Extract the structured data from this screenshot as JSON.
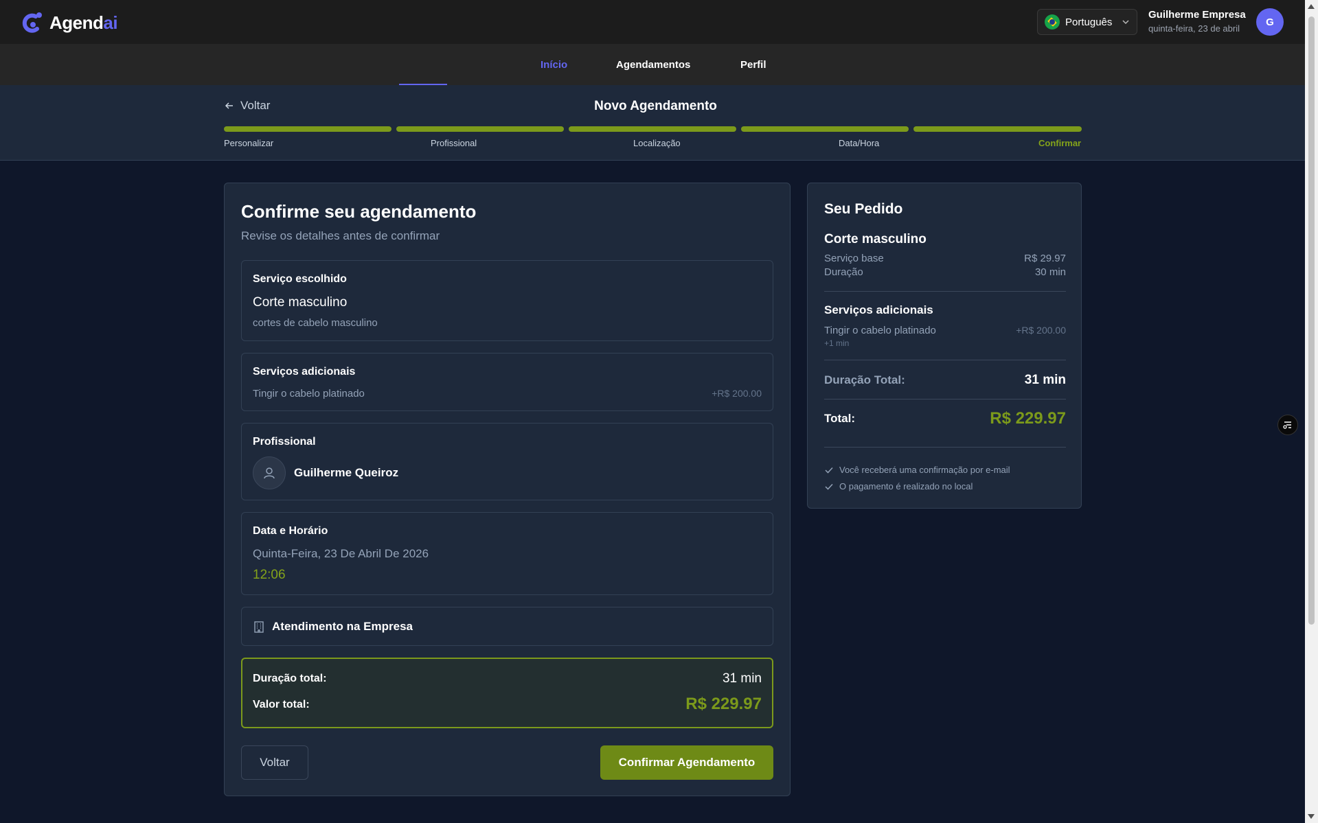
{
  "app": {
    "logo_main": "Agend",
    "logo_accent": "ai"
  },
  "header": {
    "language": "Português",
    "user_name": "Guilherme Empresa",
    "user_date": "quinta-feira, 23 de abril",
    "avatar_initial": "G"
  },
  "nav": {
    "items": [
      {
        "label": "Início"
      },
      {
        "label": "Agendamentos"
      },
      {
        "label": "Perfil"
      }
    ],
    "active": "Início"
  },
  "steps": {
    "back_label": "Voltar",
    "title": "Novo Agendamento",
    "labels": [
      "Personalizar",
      "Profissional",
      "Localização",
      "Data/Hora",
      "Confirmar"
    ],
    "current": "Confirmar"
  },
  "main": {
    "title": "Confirme seu agendamento",
    "subtitle": "Revise os detalhes antes de confirmar",
    "service": {
      "title": "Serviço escolhido",
      "name": "Corte masculino",
      "description": "cortes de cabelo masculino"
    },
    "extras": {
      "title": "Serviços adicionais",
      "item": "Tingir o cabelo platinado",
      "price": "+R$ 200.00"
    },
    "professional": {
      "title": "Profissional",
      "name": "Guilherme Queiroz"
    },
    "datetime": {
      "title": "Data e Horário",
      "date": "Quinta-Feira, 23 De Abril De 2026",
      "time": "12:06"
    },
    "location": {
      "label": "Atendimento na Empresa"
    },
    "totals": {
      "duration_label": "Duração total:",
      "duration_value": "31 min",
      "value_label": "Valor total:",
      "value": "R$ 229.97"
    },
    "buttons": {
      "back": "Voltar",
      "confirm": "Confirmar Agendamento"
    }
  },
  "order": {
    "title": "Seu Pedido",
    "service_name": "Corte masculino",
    "base_label": "Serviço base",
    "base_value": "R$ 29.97",
    "duration_label": "Duração",
    "duration_value": "30 min",
    "extras_title": "Serviços adicionais",
    "extra_item": "Tingir o cabelo platinado",
    "extra_price": "+R$ 200.00",
    "extra_duration": "+1 min",
    "total_duration_label": "Duração Total:",
    "total_duration_value": "31 min",
    "total_label": "Total:",
    "total_value": "R$ 229.97",
    "notes": [
      "Você receberá uma confirmação por e-mail",
      "O pagamento é realizado no local"
    ]
  },
  "colors": {
    "accent": "#6366f1",
    "success": "#7c9a1b",
    "background": "#0f172a",
    "card": "#1e293b"
  },
  "icons": [
    "logo-icon",
    "brazil-flag-icon",
    "chevron-down-icon",
    "arrow-left-icon",
    "user-icon",
    "building-icon",
    "check-icon",
    "menu-filter-icon"
  ]
}
